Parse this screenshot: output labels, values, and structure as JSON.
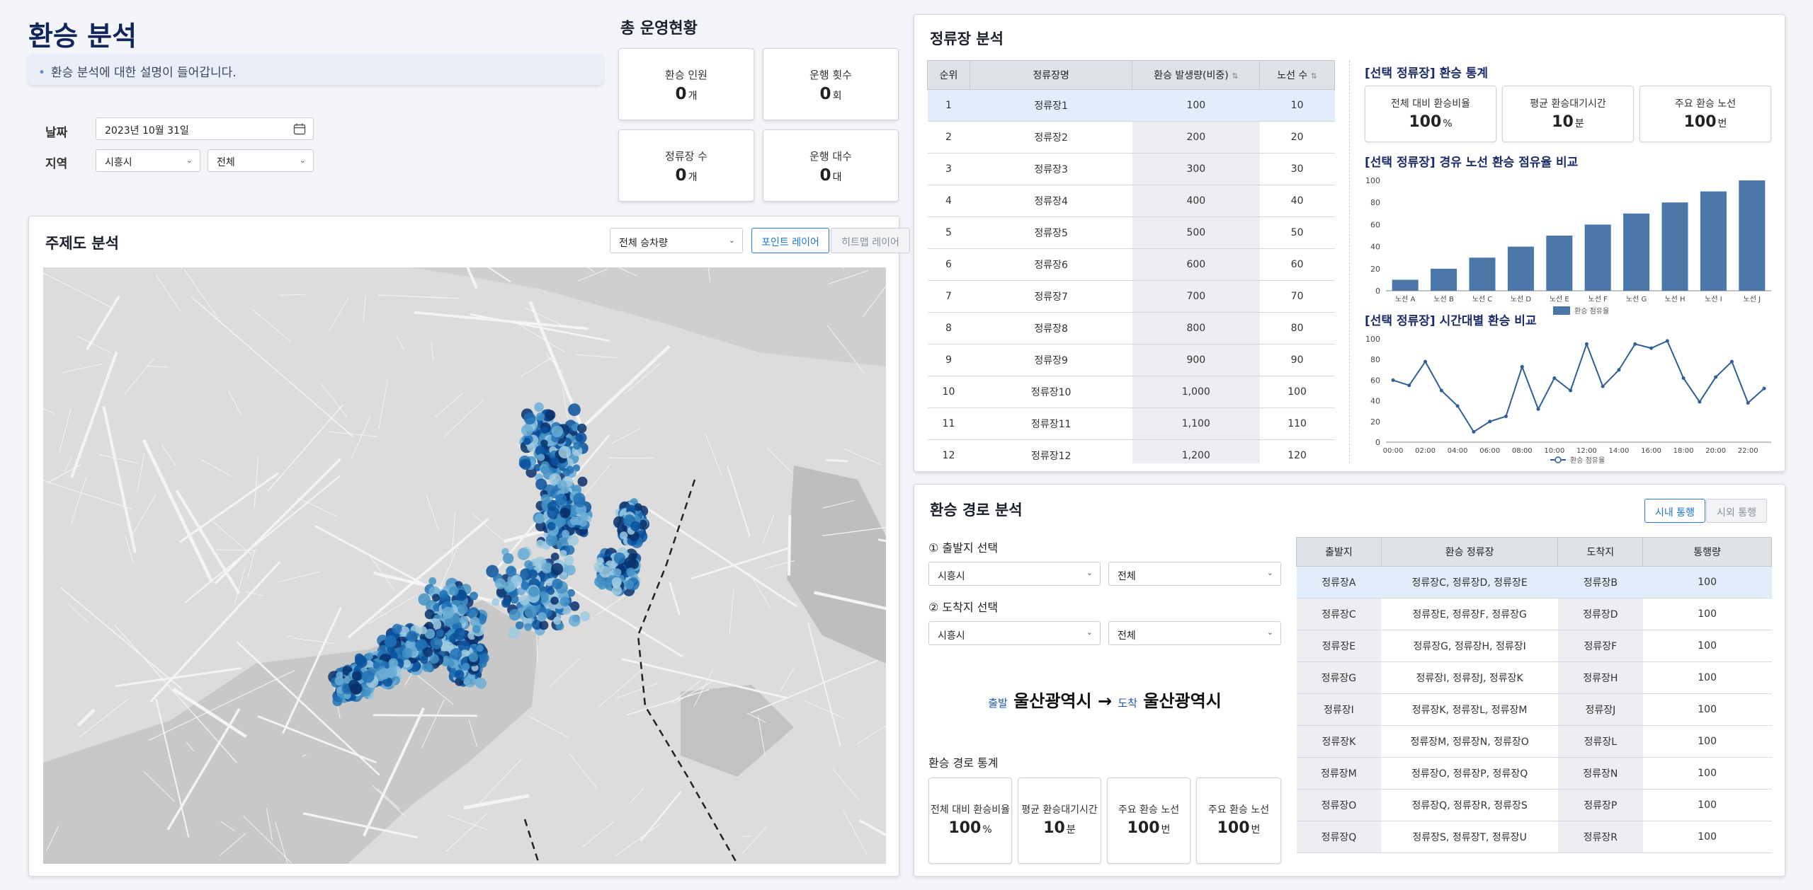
{
  "header": {
    "title": "환승 분석",
    "description": "환승 분석에 대한 설명이 들어갑니다."
  },
  "filters": {
    "date_label": "날짜",
    "date_value": "2023년 10월 31일",
    "region_label": "지역",
    "region_city": "시흥시",
    "region_district": "전체"
  },
  "overview": {
    "title": "총 운영현황",
    "kpis": [
      {
        "label": "환승 인원",
        "value": "0",
        "unit": "개"
      },
      {
        "label": "운행 횟수",
        "value": "0",
        "unit": "회"
      },
      {
        "label": "정류장 수",
        "value": "0",
        "unit": "개"
      },
      {
        "label": "운행 대수",
        "value": "0",
        "unit": "대"
      }
    ]
  },
  "map_panel": {
    "title": "주제도 분석",
    "select_value": "전체 승차량",
    "point_layer": "포인트 레이어",
    "heatmap_layer": "히트맵 레이어"
  },
  "stop_panel": {
    "title": "정류장 분석",
    "columns": [
      "순위",
      "정류장명",
      "환승 발생량(비중)",
      "노선 수"
    ],
    "rows": [
      [
        "1",
        "정류장1",
        "100",
        "10"
      ],
      [
        "2",
        "정류장2",
        "200",
        "20"
      ],
      [
        "3",
        "정류장3",
        "300",
        "30"
      ],
      [
        "4",
        "정류장4",
        "400",
        "40"
      ],
      [
        "5",
        "정류장5",
        "500",
        "50"
      ],
      [
        "6",
        "정류장6",
        "600",
        "60"
      ],
      [
        "7",
        "정류장7",
        "700",
        "70"
      ],
      [
        "8",
        "정류장8",
        "800",
        "80"
      ],
      [
        "9",
        "정류장9",
        "900",
        "90"
      ],
      [
        "10",
        "정류장10",
        "1,000",
        "100"
      ],
      [
        "11",
        "정류장11",
        "1,100",
        "110"
      ],
      [
        "12",
        "정류장12",
        "1,200",
        "120"
      ]
    ],
    "stats_title": "[선택 정류장] 환승 통계",
    "stats": [
      {
        "label": "전체 대비 환승비율",
        "value": "100",
        "unit": "%"
      },
      {
        "label": "평균 환승대기시간",
        "value": "10",
        "unit": "분"
      },
      {
        "label": "주요 환승 노선",
        "value": "100",
        "unit": "번"
      }
    ],
    "bar_title": "[선택 정류장] 경유 노선 환승 점유율 비교",
    "line_title": "[선택 정류장] 시간대별 환승 비교"
  },
  "chart_data": [
    {
      "type": "bar",
      "categories": [
        "노선 A",
        "노선 B",
        "노선 C",
        "노선 D",
        "노선 E",
        "노선 F",
        "노선 G",
        "노선 H",
        "노선 I",
        "노선 J"
      ],
      "series": [
        {
          "name": "환승 점유율",
          "values": [
            10,
            20,
            30,
            40,
            50,
            60,
            70,
            80,
            90,
            100
          ]
        }
      ],
      "ylim": [
        0,
        100
      ],
      "yticks": [
        0,
        20,
        40,
        60,
        80,
        100
      ],
      "color": "#4a76a8",
      "legend": "bottom",
      "grid": false
    },
    {
      "type": "line",
      "x": [
        "00:00",
        "01:00",
        "02:00",
        "03:00",
        "04:00",
        "05:00",
        "06:00",
        "07:00",
        "08:00",
        "09:00",
        "10:00",
        "11:00",
        "12:00",
        "13:00",
        "14:00",
        "15:00",
        "16:00",
        "17:00",
        "18:00",
        "19:00",
        "20:00",
        "21:00",
        "22:00",
        "23:00"
      ],
      "xticks": [
        "00:00",
        "02:00",
        "04:00",
        "06:00",
        "08:00",
        "10:00",
        "12:00",
        "14:00",
        "16:00",
        "18:00",
        "20:00",
        "22:00"
      ],
      "series": [
        {
          "name": "환승 점유율",
          "values": [
            60,
            55,
            78,
            50,
            35,
            10,
            20,
            25,
            73,
            32,
            62,
            50,
            95,
            54,
            70,
            95,
            91,
            98,
            62,
            39,
            63,
            78,
            38,
            52
          ]
        }
      ],
      "ylim": [
        0,
        100
      ],
      "yticks": [
        0,
        20,
        40,
        60,
        80,
        100
      ],
      "color": "#2f5f96",
      "legend": "bottom",
      "grid": false
    }
  ],
  "route_panel": {
    "title": "환승 경로 분석",
    "tab_city": "시내 통행",
    "tab_outside": "시외 통행",
    "origin_label": "① 출발지 선택",
    "origin_city": "시흥시",
    "origin_district": "전체",
    "dest_label": "② 도착지 선택",
    "dest_city": "시흥시",
    "dest_district": "전체",
    "from_word": "출발",
    "from_place": "울산광역시",
    "arrow": "→",
    "to_word": "도착",
    "to_place": "울산광역시",
    "stats_title": "환승 경로 통계",
    "stats": [
      {
        "label": "전체 대비 환승비율",
        "value": "100",
        "unit": "%"
      },
      {
        "label": "평균 환승대기시간",
        "value": "10",
        "unit": "분"
      },
      {
        "label": "주요 환승 노선",
        "value": "100",
        "unit": "번"
      },
      {
        "label": "주요 환승 노선",
        "value": "100",
        "unit": "번"
      }
    ],
    "columns": [
      "출발지",
      "환승 정류장",
      "도착지",
      "통행량"
    ],
    "rows": [
      [
        "정류장A",
        "정류장C, 정류장D, 정류장E",
        "정류장B",
        "100"
      ],
      [
        "정류장C",
        "정류장E, 정류장F, 정류장G",
        "정류장D",
        "100"
      ],
      [
        "정류장E",
        "정류장G, 정류장H, 정류장I",
        "정류장F",
        "100"
      ],
      [
        "정류장G",
        "정류장I, 정류장J, 정류장K",
        "정류장H",
        "100"
      ],
      [
        "정류장I",
        "정류장K, 정류장L, 정류장M",
        "정류장J",
        "100"
      ],
      [
        "정류장K",
        "정류장M, 정류장N, 정류장O",
        "정류장L",
        "100"
      ],
      [
        "정류장M",
        "정류장O, 정류장P, 정류장Q",
        "정류장N",
        "100"
      ],
      [
        "정류장O",
        "정류장Q, 정류장R, 정류장S",
        "정류장P",
        "100"
      ],
      [
        "정류장Q",
        "정류장S, 정류장T, 정류장U",
        "정류장R",
        "100"
      ]
    ]
  }
}
